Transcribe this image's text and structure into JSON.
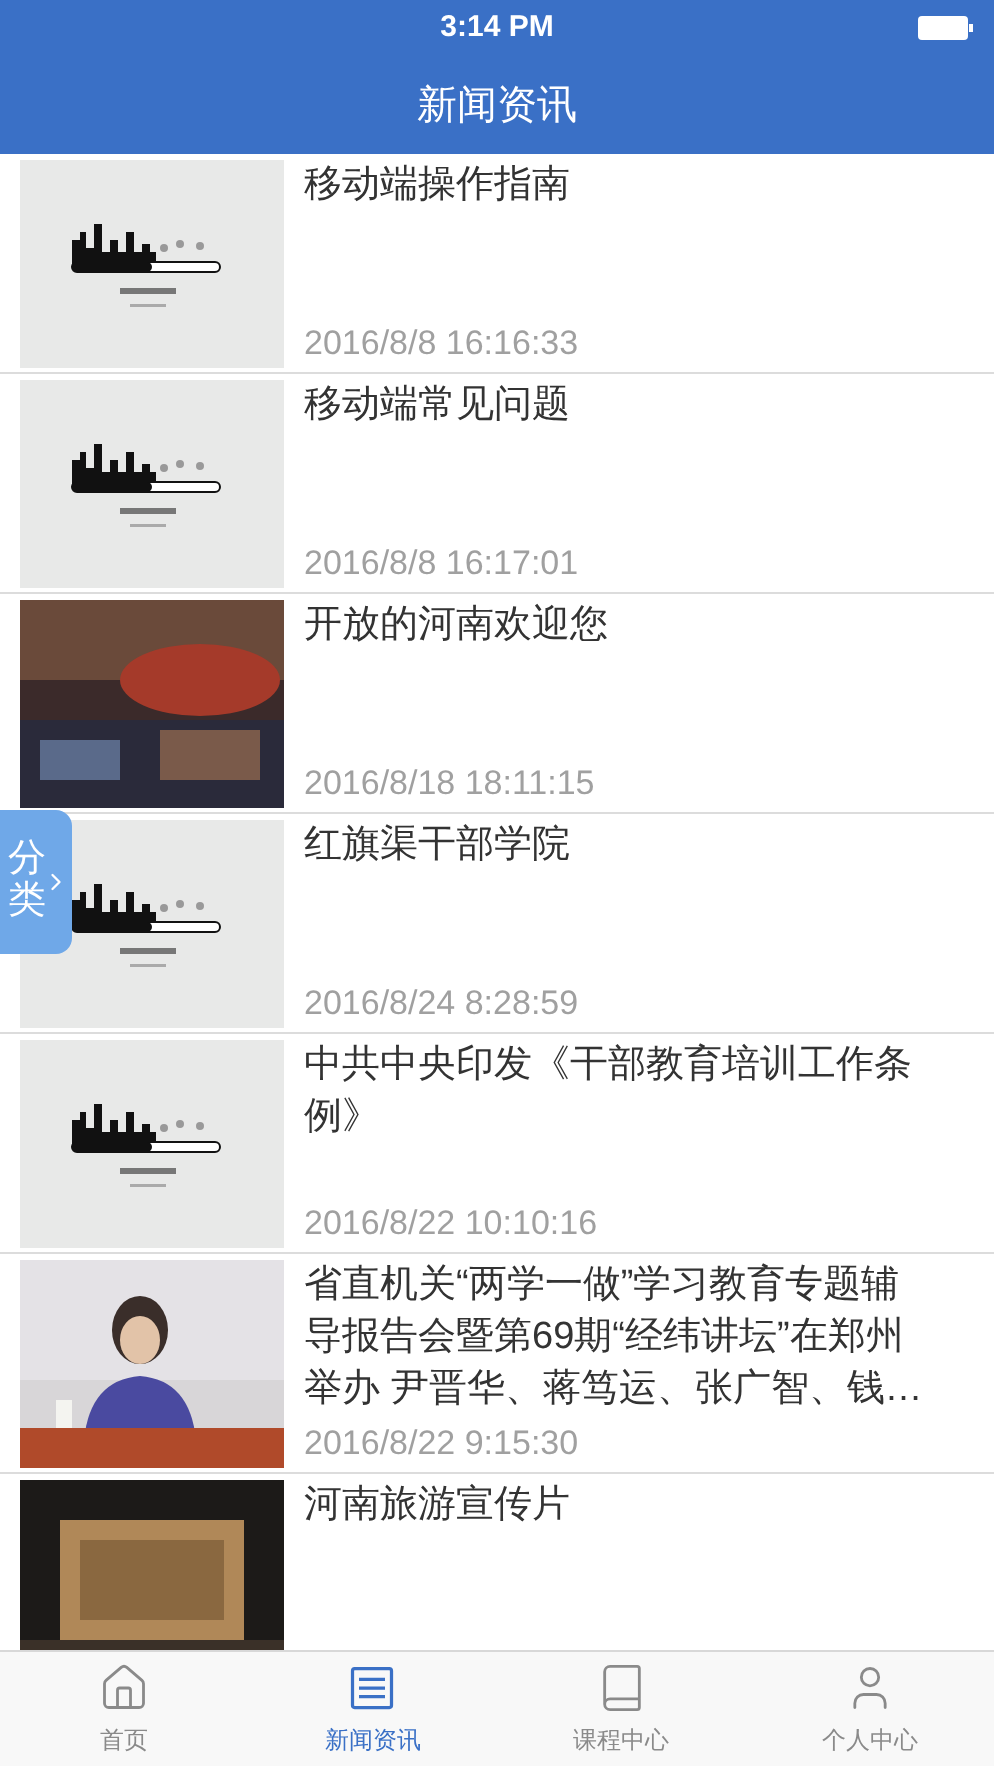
{
  "status_bar": {
    "time": "3:14 PM"
  },
  "header": {
    "title": "新闻资讯"
  },
  "news": [
    {
      "title": "移动端操作指南",
      "date": "2016/8/8 16:16:33",
      "thumbnail": {
        "kind": "loading"
      }
    },
    {
      "title": "移动端常见问题",
      "date": "2016/8/8 16:17:01",
      "thumbnail": {
        "kind": "loading"
      }
    },
    {
      "title": "开放的河南欢迎您",
      "date": "2016/8/18 18:11:15",
      "thumbnail": {
        "kind": "banner"
      }
    },
    {
      "title": "红旗渠干部学院",
      "date": "2016/8/24 8:28:59",
      "thumbnail": {
        "kind": "loading"
      }
    },
    {
      "title": "中共中央印发《干部教育培训工作条例》",
      "date": "2016/8/22 10:10:16",
      "thumbnail": {
        "kind": "loading"
      }
    },
    {
      "title": "省直机关“两学一做”学习教育专题辅导报告会暨第69期“经纬讲坛”在郑州举办 尹晋华、蒋笃运、张广智、钱…",
      "date": "2016/8/22 9:15:30",
      "thumbnail": {
        "kind": "speaker"
      }
    },
    {
      "title": "河南旅游宣传片",
      "thumbnail": {
        "kind": "monument"
      }
    }
  ],
  "side_tab": {
    "label": "分类"
  },
  "tabs": [
    {
      "label": "首页",
      "kind": "home",
      "selected": false
    },
    {
      "label": "新闻资讯",
      "kind": "news",
      "selected": true
    },
    {
      "label": "课程中心",
      "kind": "book",
      "selected": false
    },
    {
      "label": "个人中心",
      "kind": "user",
      "selected": false
    }
  ]
}
